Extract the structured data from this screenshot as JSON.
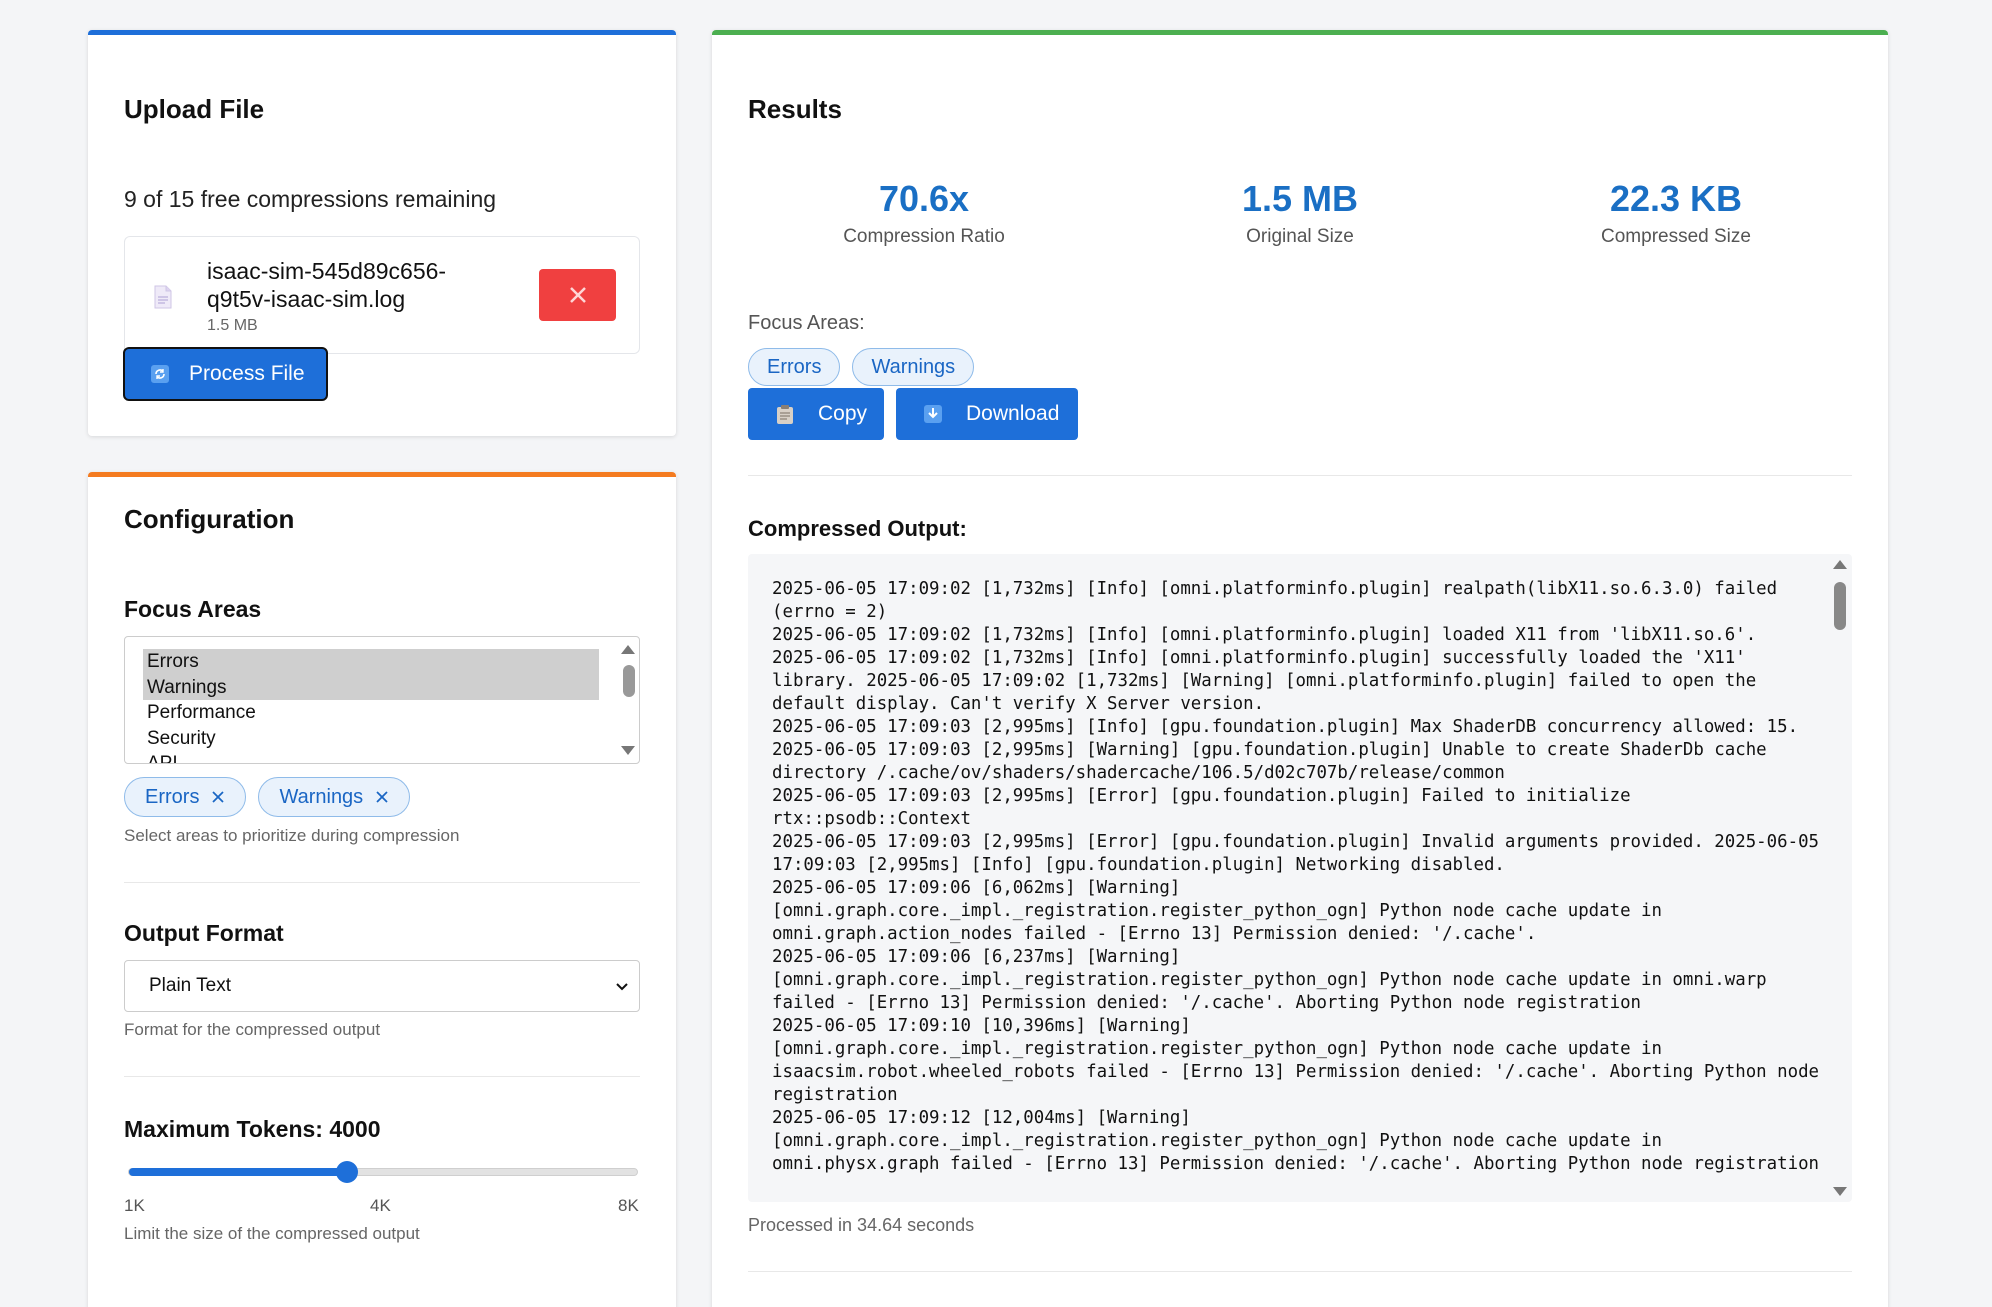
{
  "upload": {
    "title": "Upload File",
    "remaining": "9 of 15 free compressions remaining",
    "file_name": "isaac-sim-545d89c656-q9t5v-isaac-sim.log",
    "file_size": "1.5 MB",
    "process_label": "Process File"
  },
  "config": {
    "title": "Configuration",
    "focus_label": "Focus Areas",
    "options": [
      "Errors",
      "Warnings",
      "Performance",
      "Security",
      "API"
    ],
    "selected_chips": [
      "Errors",
      "Warnings"
    ],
    "focus_help": "Select areas to prioritize during compression",
    "format_label": "Output Format",
    "format_value": "Plain Text",
    "format_help": "Format for the compressed output",
    "tokens_label": "Maximum Tokens: 4000",
    "tokens_value": 4000,
    "tokens_min": 1000,
    "tokens_max": 8000,
    "tick_min": "1K",
    "tick_mid": "4K",
    "tick_max": "8K",
    "tokens_help": "Limit the size of the compressed output"
  },
  "results": {
    "title": "Results",
    "ratio_value": "70.6x",
    "ratio_label": "Compression Ratio",
    "original_value": "1.5 MB",
    "original_label": "Original Size",
    "compressed_value": "22.3 KB",
    "compressed_label": "Compressed Size",
    "focus_label": "Focus Areas:",
    "focus_chips": [
      "Errors",
      "Warnings"
    ],
    "copy_label": "Copy",
    "download_label": "Download",
    "output_label": "Compressed Output:",
    "output_text": "2025-06-05 17:09:02 [1,732ms] [Info] [omni.platforminfo.plugin] realpath(libX11.so.6.3.0) failed (errno = 2)\n2025-06-05 17:09:02 [1,732ms] [Info] [omni.platforminfo.plugin] loaded X11 from 'libX11.so.6'.\n2025-06-05 17:09:02 [1,732ms] [Info] [omni.platforminfo.plugin] successfully loaded the 'X11' library. 2025-06-05 17:09:02 [1,732ms] [Warning] [omni.platforminfo.plugin] failed to open the default display. Can't verify X Server version.\n2025-06-05 17:09:03 [2,995ms] [Info] [gpu.foundation.plugin] Max ShaderDB concurrency allowed: 15. 2025-06-05 17:09:03 [2,995ms] [Warning] [gpu.foundation.plugin] Unable to create ShaderDb cache directory /.cache/ov/shaders/shadercache/106.5/d02c707b/release/common\n2025-06-05 17:09:03 [2,995ms] [Error] [gpu.foundation.plugin] Failed to initialize rtx::psodb::Context\n2025-06-05 17:09:03 [2,995ms] [Error] [gpu.foundation.plugin] Invalid arguments provided. 2025-06-05 17:09:03 [2,995ms] [Info] [gpu.foundation.plugin] Networking disabled.\n2025-06-05 17:09:06 [6,062ms] [Warning]\n[omni.graph.core._impl._registration.register_python_ogn] Python node cache update in omni.graph.action_nodes failed - [Errno 13] Permission denied: '/.cache'.\n2025-06-05 17:09:06 [6,237ms] [Warning]\n[omni.graph.core._impl._registration.register_python_ogn] Python node cache update in omni.warp failed - [Errno 13] Permission denied: '/.cache'. Aborting Python node registration\n2025-06-05 17:09:10 [10,396ms] [Warning]\n[omni.graph.core._impl._registration.register_python_ogn] Python node cache update in isaacsim.robot.wheeled_robots failed - [Errno 13] Permission denied: '/.cache'. Aborting Python node registration\n2025-06-05 17:09:12 [12,004ms] [Warning]\n[omni.graph.core._impl._registration.register_python_ogn] Python node cache update in omni.physx.graph failed - [Errno 13] Permission denied: '/.cache'. Aborting Python node registration",
    "processed": "Processed in 34.64 seconds"
  }
}
